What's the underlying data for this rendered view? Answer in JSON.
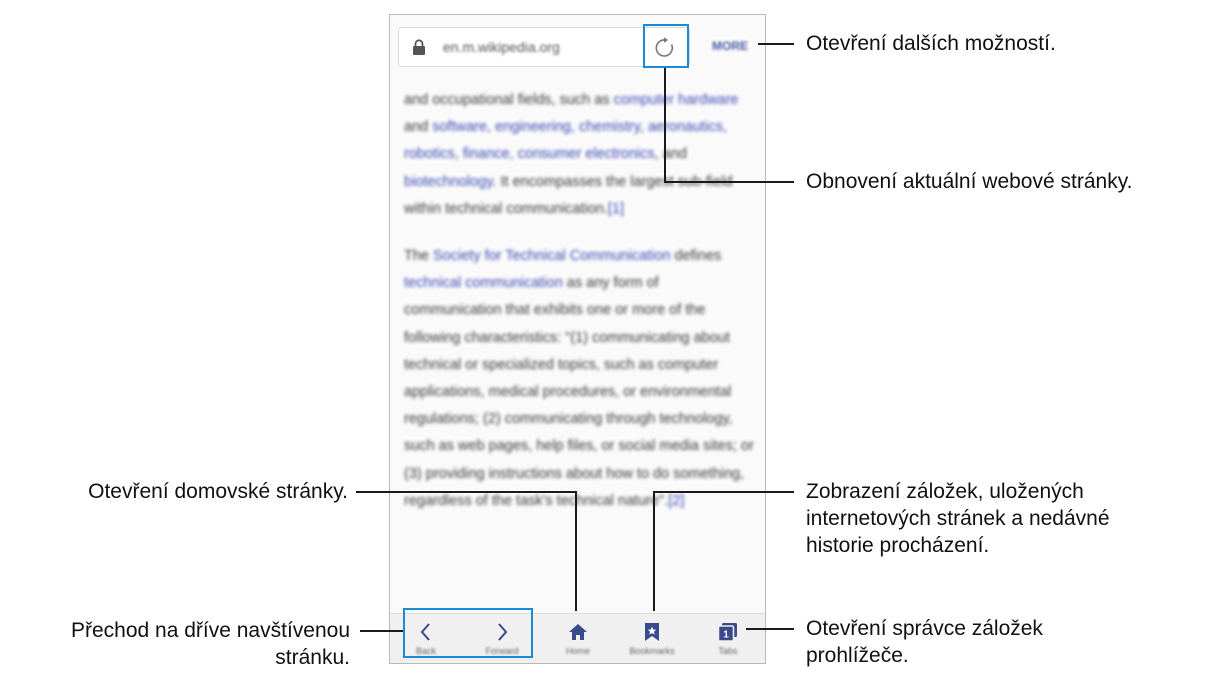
{
  "browser": {
    "url": "en.m.wikipedia.org",
    "more_label": "MORE",
    "paragraphs": [
      {
        "segments": [
          {
            "text": "and occupational fields, such as ",
            "link": false
          },
          {
            "text": "computer hardware",
            "link": true
          },
          {
            "text": " and ",
            "link": false
          },
          {
            "text": "software, engineering,",
            "link": true
          },
          {
            "text": " ",
            "link": false
          },
          {
            "text": "chemistry, aeronautics, robotics, finance,",
            "link": true
          },
          {
            "text": " ",
            "link": false
          },
          {
            "text": "consumer electronics",
            "link": true
          },
          {
            "text": ", and ",
            "link": false
          },
          {
            "text": "biotechnology",
            "link": true
          },
          {
            "text": ". It encompasses the largest sub-field within technical communication.",
            "link": false
          },
          {
            "text": "[1]",
            "link": true
          }
        ]
      },
      {
        "segments": [
          {
            "text": "The ",
            "link": false
          },
          {
            "text": "Society for Technical Communication",
            "link": true
          },
          {
            "text": " defines ",
            "link": false
          },
          {
            "text": "technical communication",
            "link": true
          },
          {
            "text": " as any form of communication that exhibits one or more of the following characteristics: \"(1) communicating about technical or specialized topics, such as computer applications, medical procedures, or environmental regulations; (2) communicating through technology, such as web pages, help files, or social media sites; or (3) providing instructions about how to do something, regardless of the task's technical nature\".",
            "link": false
          },
          {
            "text": "[2]",
            "link": true
          }
        ]
      }
    ],
    "bottom_nav": [
      {
        "label": "Back",
        "icon": "chevron-left-icon"
      },
      {
        "label": "Forward",
        "icon": "chevron-right-icon"
      },
      {
        "label": "Home",
        "icon": "home-icon"
      },
      {
        "label": "Bookmarks",
        "icon": "bookmark-icon"
      },
      {
        "label": "Tabs",
        "icon": "tabs-icon"
      }
    ]
  },
  "callouts": {
    "more": "Otevření dalších možností.",
    "refresh": "Obnovení aktuální webové stránky.",
    "home": "Otevření domovské stránky.",
    "bookmarks_line1": "Zobrazení záložek, uložených",
    "bookmarks_line2": "internetových stránek a nedávné",
    "bookmarks_line3": "historie procházení.",
    "tabs_line1": "Otevření správce záložek",
    "tabs_line2": "prohlížeče.",
    "backforward_line1": "Přechod na dříve navštívenou",
    "backforward_line2": "stránku."
  },
  "colors": {
    "highlight": "#1a8ad4",
    "link": "#3b49b4",
    "icon": "#3b4a8c"
  }
}
